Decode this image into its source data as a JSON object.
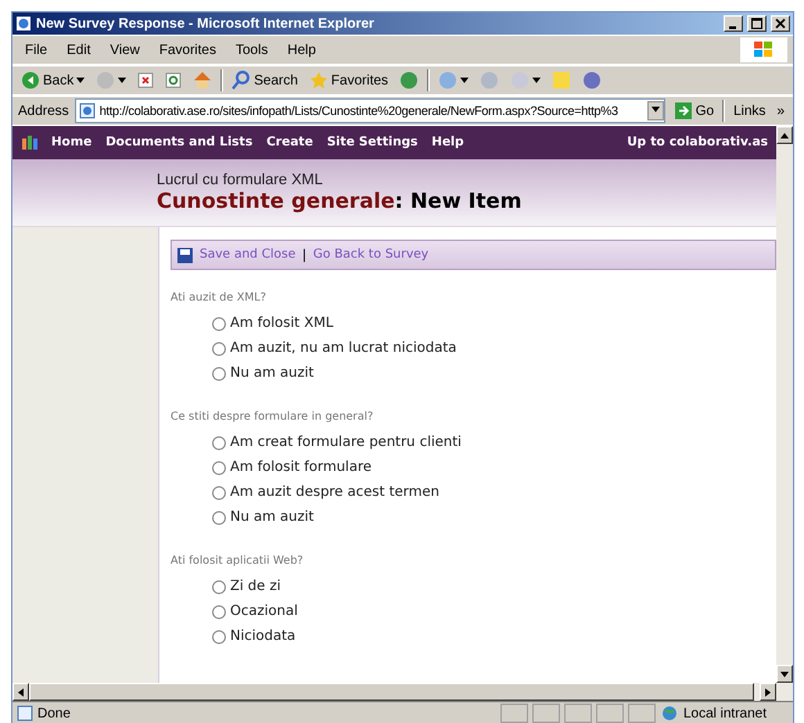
{
  "window": {
    "title": "New Survey Response - Microsoft Internet Explorer"
  },
  "menu": [
    "File",
    "Edit",
    "View",
    "Favorites",
    "Tools",
    "Help"
  ],
  "toolbar": {
    "back": "Back",
    "search": "Search",
    "favorites": "Favorites"
  },
  "address": {
    "label": "Address",
    "value": "http://colaborativ.ase.ro/sites/infopath/Lists/Cunostinte%20generale/NewForm.aspx?Source=http%3",
    "go": "Go",
    "links": "Links",
    "more": "»"
  },
  "nav": {
    "items": [
      "Home",
      "Documents and Lists",
      "Create",
      "Site Settings",
      "Help"
    ],
    "up": "Up to colaborativ.as"
  },
  "header": {
    "site": "Lucrul cu formulare XML",
    "list": "Cunostinte generale",
    "separator": ": ",
    "page": "New Item"
  },
  "actions": {
    "save": "Save and Close",
    "divider": "|",
    "back": "Go Back to Survey"
  },
  "questions": [
    {
      "label": "Ati auzit de XML?",
      "options": [
        {
          "label": "Am folosit XML",
          "selected": false
        },
        {
          "label": "Am auzit, nu am lucrat niciodata",
          "selected": false
        },
        {
          "label": "Nu am auzit",
          "selected": false
        }
      ]
    },
    {
      "label": "Ce stiti despre formulare in general?",
      "options": [
        {
          "label": "Am creat formulare pentru clienti",
          "selected": false
        },
        {
          "label": "Am folosit formulare",
          "selected": false
        },
        {
          "label": "Am auzit despre acest termen",
          "selected": false
        },
        {
          "label": "Nu am auzit",
          "selected": false
        }
      ]
    },
    {
      "label": "Ati folosit aplicatii Web?",
      "options": [
        {
          "label": "Zi de zi",
          "selected": false
        },
        {
          "label": "Ocazional",
          "selected": false
        },
        {
          "label": "Niciodata",
          "selected": false
        }
      ]
    }
  ],
  "status": {
    "text": "Done",
    "zone": "Local intranet"
  }
}
